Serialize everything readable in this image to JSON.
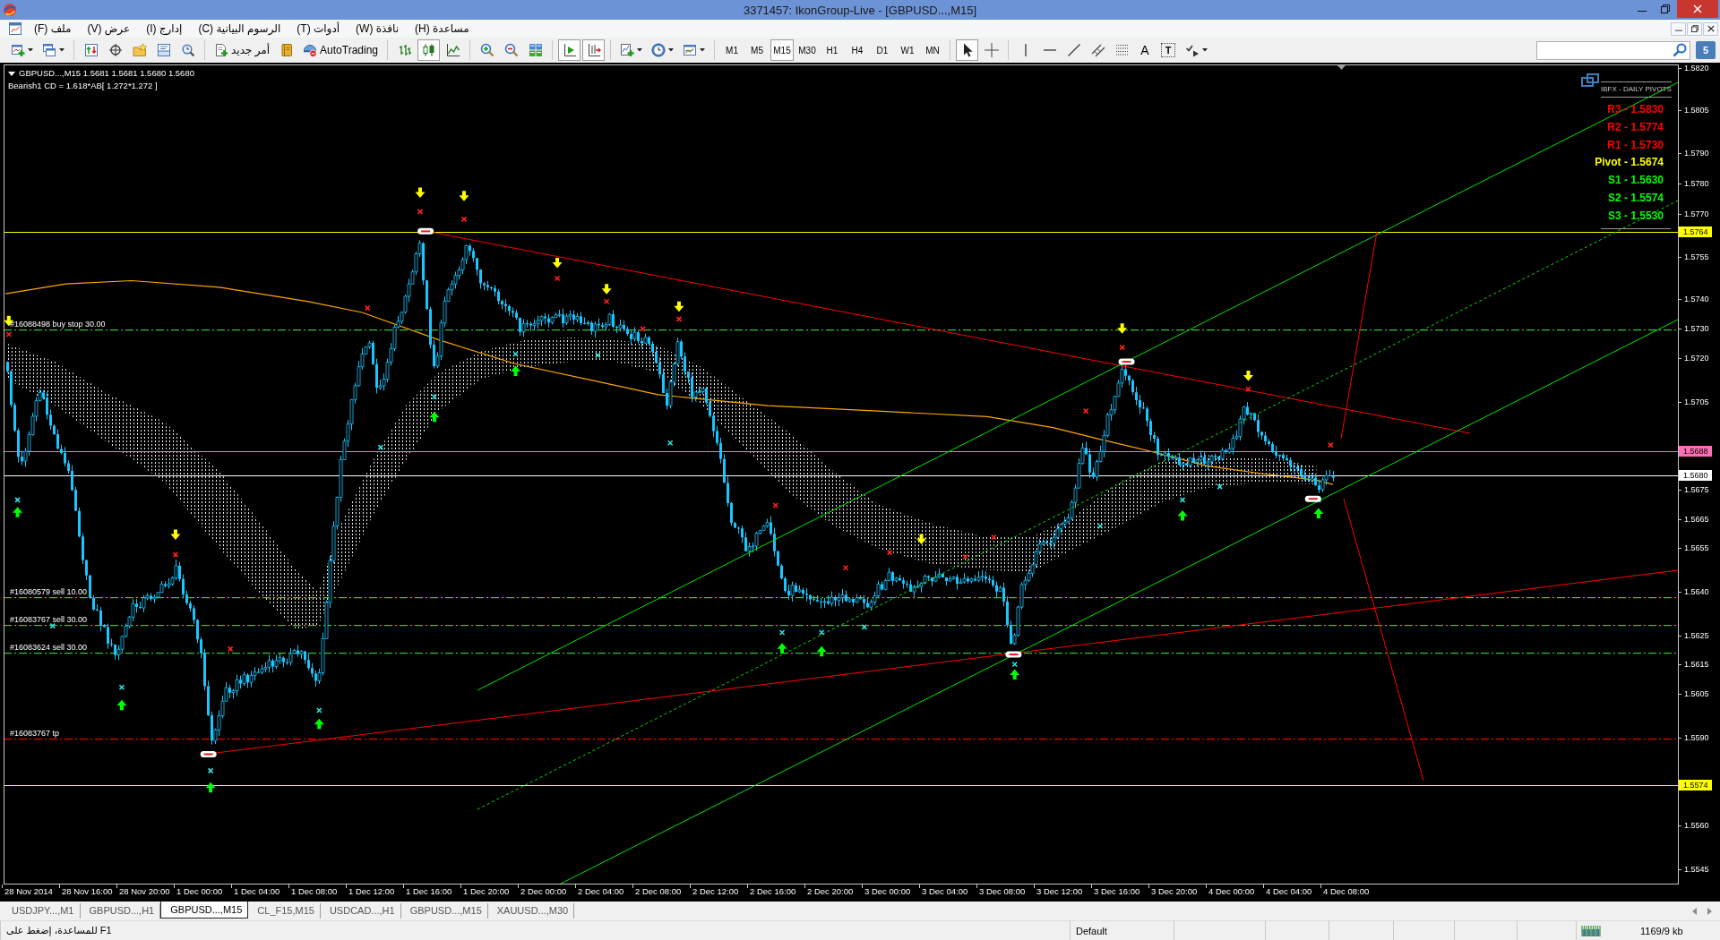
{
  "window": {
    "title": "3371457: IkonGroup-Live - [GBPUSD...,M15]"
  },
  "menu": [
    "مساعدة (H)",
    "نافذة (W)",
    "أدوات (T)",
    "الرسوم البيانية (C)",
    "إدارج (I)",
    "عرض (V)",
    "ملف (F)"
  ],
  "toolbar": {
    "new_order": "أمر جديد",
    "autotrading": "AutoTrading",
    "chart_types": [
      {
        "kind": "bars",
        "selected": false
      },
      {
        "kind": "candles",
        "selected": true
      },
      {
        "kind": "line",
        "selected": false
      }
    ],
    "auto_scroll": {
      "on": true
    },
    "chart_shift": {
      "on": true
    },
    "periods": [
      {
        "label": "M1",
        "selected": false
      },
      {
        "label": "M5",
        "selected": false
      },
      {
        "label": "M15",
        "selected": true
      },
      {
        "label": "M30",
        "selected": false
      },
      {
        "label": "H1",
        "selected": false
      },
      {
        "label": "H4",
        "selected": false
      },
      {
        "label": "D1",
        "selected": false
      },
      {
        "label": "W1",
        "selected": false
      },
      {
        "label": "MN",
        "selected": false
      }
    ],
    "cursor_modes": [
      {
        "kind": "cursor",
        "selected": true
      },
      {
        "kind": "crosshair",
        "selected": false
      }
    ],
    "text_tools": [
      {
        "kind": "text",
        "label": "A"
      },
      {
        "kind": "label",
        "label": "T"
      }
    ],
    "messages_badge": "5"
  },
  "chart": {
    "header": [
      "GBPUSD...,M15 1.5681 1.5681 1.5680 1.5680",
      "Bearish1 CD = 1.618*AB[ 1.272*1.272 ]"
    ],
    "pivots": {
      "title": "IBFX - DAILY PIVOTS",
      "levels": [
        {
          "text": "R3 - 1.5830",
          "color": "#ff0000"
        },
        {
          "text": "R2 - 1.5774",
          "color": "#ff0000"
        },
        {
          "text": "R1 - 1.5730",
          "color": "#ff0000"
        },
        {
          "text": "Pivot - 1.5674",
          "color": "#ffff00"
        },
        {
          "text": "S1 - 1.5630",
          "color": "#00ff00"
        },
        {
          "text": "S2 - 1.5574",
          "color": "#00ff00"
        },
        {
          "text": "S3 - 1.5530",
          "color": "#00ff00"
        }
      ]
    },
    "order_lines": [
      {
        "label": "#16088498 buy stop 30.00",
        "color": "#32cd32"
      },
      {
        "label": "#16080579 sell 10.00",
        "color": "#32cd32"
      },
      {
        "label": "#16083767 sell 30.00",
        "color": "#32cd32"
      },
      {
        "label": "#16083624 sell 30.00",
        "color": "#32cd32"
      },
      {
        "label": "#16083767 tp",
        "color": "#ff0000"
      }
    ],
    "price_tags": [
      {
        "text": "1.5764",
        "color": "#ffff00"
      },
      {
        "text": "1.5688",
        "color": "#ff6eb4"
      },
      {
        "text": "1.5680",
        "color": "#ffffff"
      },
      {
        "text": "1.5574",
        "color": "#ffff00"
      }
    ],
    "price_axis": [
      "1.5820",
      "1.5805",
      "1.5790",
      "1.5780",
      "1.5770",
      "1.5755",
      "1.5740",
      "1.5730",
      "1.5720",
      "1.5705",
      "1.5675",
      "1.5665",
      "1.5655",
      "1.5640",
      "1.5625",
      "1.5615",
      "1.5605",
      "1.5590",
      "1.5560",
      "1.5545"
    ],
    "time_axis": [
      "28 Nov 2014",
      "28 Nov 16:00",
      "28 Nov 20:00",
      "1 Dec 00:00",
      "1 Dec 04:00",
      "1 Dec 08:00",
      "1 Dec 12:00",
      "1 Dec 16:00",
      "1 Dec 20:00",
      "2 Dec 00:00",
      "2 Dec 04:00",
      "2 Dec 08:00",
      "2 Dec 12:00",
      "2 Dec 16:00",
      "2 Dec 20:00",
      "3 Dec 00:00",
      "3 Dec 04:00",
      "3 Dec 08:00",
      "3 Dec 12:00",
      "3 Dec 16:00",
      "3 Dec 20:00",
      "4 Dec 00:00",
      "4 Dec 04:00",
      "4 Dec 08:00"
    ]
  },
  "tabs": [
    {
      "label": "USDJPY...,M1",
      "selected": false
    },
    {
      "label": "GBPUSD...,H1",
      "selected": false
    },
    {
      "label": "GBPUSD...,M15",
      "selected": true
    },
    {
      "label": "CL_F15,M15",
      "selected": false
    },
    {
      "label": "USDCAD...,H1",
      "selected": false
    },
    {
      "label": "GBPUSD...,M15",
      "selected": false
    },
    {
      "label": "XAUUSD...,M30",
      "selected": false
    }
  ],
  "status_bar": {
    "help": "للمساعدة، إضغط على F1",
    "profile": "Default",
    "traffic": "1169/9 kb"
  }
}
